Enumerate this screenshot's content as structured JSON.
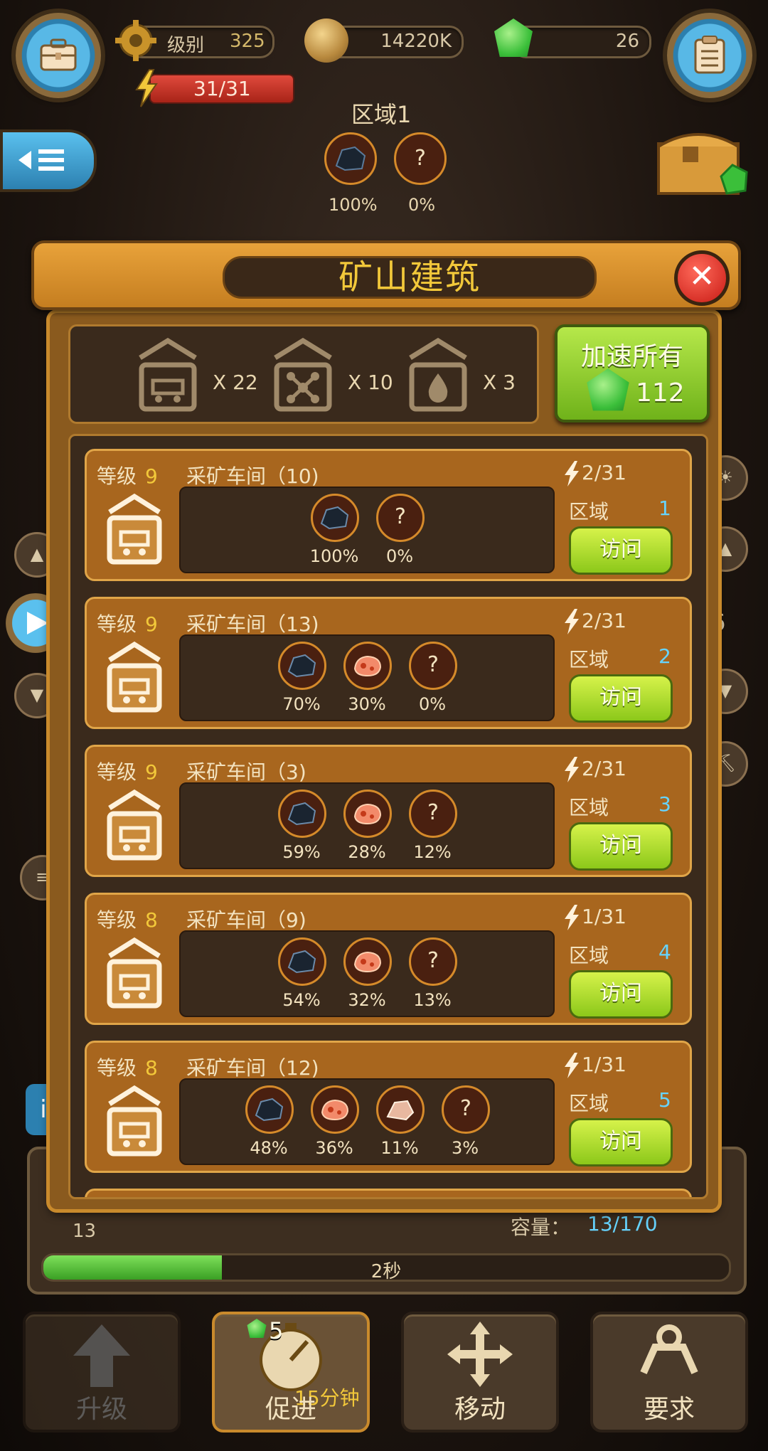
{
  "hud": {
    "level_label": "级别",
    "level_value": "325",
    "coins": "14220K",
    "gems": "26",
    "energy": "31/31"
  },
  "zone_header": {
    "title": "区域1",
    "resources": [
      {
        "icon": "coal-ore-icon",
        "pct": "100%"
      },
      {
        "icon": "unknown-ore-icon",
        "symbol": "?",
        "pct": "0%"
      }
    ]
  },
  "dialog": {
    "title": "矿山建筑",
    "summary": [
      {
        "icon": "mine-cart-building-icon",
        "count": "X 22"
      },
      {
        "icon": "network-building-icon",
        "count": "X 10"
      },
      {
        "icon": "drop-building-icon",
        "count": "X 3"
      }
    ],
    "speed_all_label": "加速所有",
    "speed_all_cost": "112",
    "rows": [
      {
        "level_label": "等级",
        "level": "9",
        "name": "采矿车间（10)",
        "energy": "2/31",
        "zone_label": "区域",
        "zone": "1",
        "visit": "访问",
        "resources": [
          {
            "type": "coal",
            "pct": "100%"
          },
          {
            "type": "unknown",
            "symbol": "?",
            "pct": "0%"
          }
        ]
      },
      {
        "level_label": "等级",
        "level": "9",
        "name": "采矿车间（13)",
        "energy": "2/31",
        "zone_label": "区域",
        "zone": "2",
        "visit": "访问",
        "resources": [
          {
            "type": "coal",
            "pct": "70%"
          },
          {
            "type": "copper",
            "pct": "30%"
          },
          {
            "type": "unknown",
            "symbol": "?",
            "pct": "0%"
          }
        ]
      },
      {
        "level_label": "等级",
        "level": "9",
        "name": "采矿车间（3)",
        "energy": "2/31",
        "zone_label": "区域",
        "zone": "3",
        "visit": "访问",
        "resources": [
          {
            "type": "coal",
            "pct": "59%"
          },
          {
            "type": "copper",
            "pct": "28%"
          },
          {
            "type": "unknown",
            "symbol": "?",
            "pct": "12%"
          }
        ]
      },
      {
        "level_label": "等级",
        "level": "8",
        "name": "采矿车间（9)",
        "energy": "1/31",
        "zone_label": "区域",
        "zone": "4",
        "visit": "访问",
        "resources": [
          {
            "type": "coal",
            "pct": "54%"
          },
          {
            "type": "copper",
            "pct": "32%"
          },
          {
            "type": "unknown",
            "symbol": "?",
            "pct": "13%"
          }
        ]
      },
      {
        "level_label": "等级",
        "level": "8",
        "name": "采矿车间（12)",
        "energy": "1/31",
        "zone_label": "区域",
        "zone": "5",
        "visit": "访问",
        "resources": [
          {
            "type": "coal",
            "pct": "48%"
          },
          {
            "type": "copper",
            "pct": "36%"
          },
          {
            "type": "stone",
            "pct": "11%"
          },
          {
            "type": "unknown",
            "symbol": "?",
            "pct": "3%"
          }
        ]
      }
    ]
  },
  "bottom": {
    "left_value": "13",
    "capacity_label": "容量：",
    "capacity_value": "13/170",
    "progress_text": "2秒",
    "progress_fraction": 0.26,
    "actions": [
      {
        "label": "升级",
        "icon": "upgrade-arrow-icon"
      },
      {
        "label": "促进",
        "icon": "boost-stopwatch-icon",
        "badge": "5",
        "timer": "15分钟"
      },
      {
        "label": "移动",
        "icon": "move-arrows-icon"
      },
      {
        "label": "要求",
        "icon": "claw-icon"
      }
    ]
  },
  "side": {
    "right_level": "6"
  }
}
